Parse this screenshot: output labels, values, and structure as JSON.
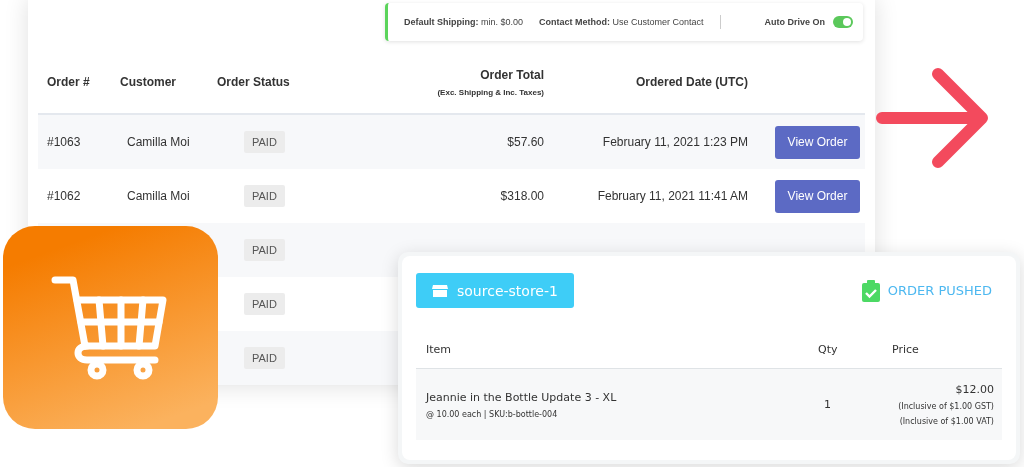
{
  "settings_bar": {
    "items": [
      {
        "label": "Default Shipping:",
        "value": "min. $0.00"
      },
      {
        "label": "Contact Method:",
        "value": "Use Customer Contact"
      }
    ],
    "toggle": {
      "label": "Auto Drive On",
      "on": true
    }
  },
  "orders_table": {
    "columns": [
      {
        "title": "Order #"
      },
      {
        "title": "Customer"
      },
      {
        "title": "Order Status"
      },
      {
        "title": "Order Total",
        "subtitle": "(Exc. Shipping & Inc. Taxes)"
      },
      {
        "title": "Ordered Date (UTC)"
      }
    ],
    "rows": [
      {
        "order": "#1063",
        "customer": "Camilla Moi",
        "status": "PAID",
        "total": "$57.60",
        "date": "February 11, 2021 1:23 PM",
        "action": "View Order"
      },
      {
        "order": "#1062",
        "customer": "Camilla Moi",
        "status": "PAID",
        "total": "$318.00",
        "date": "February 11, 2021 11:41 AM",
        "action": "View Order"
      },
      {
        "status": "PAID"
      },
      {
        "status": "PAID"
      },
      {
        "status": "PAID"
      }
    ]
  },
  "order_card": {
    "store": "source-store-1",
    "status": "ORDER PUSHED",
    "columns": [
      "Item",
      "Qty",
      "Price"
    ],
    "items": [
      {
        "name": "Jeannie in the Bottle Update 3 - XL",
        "detail": "@ 10.00 each | SKU:b-bottle-004",
        "qty": "1",
        "price": "$12.00",
        "taxes": [
          "(Inclusive of $1.00 GST)",
          "(Inclusive of $1.00 VAT)"
        ]
      }
    ]
  }
}
